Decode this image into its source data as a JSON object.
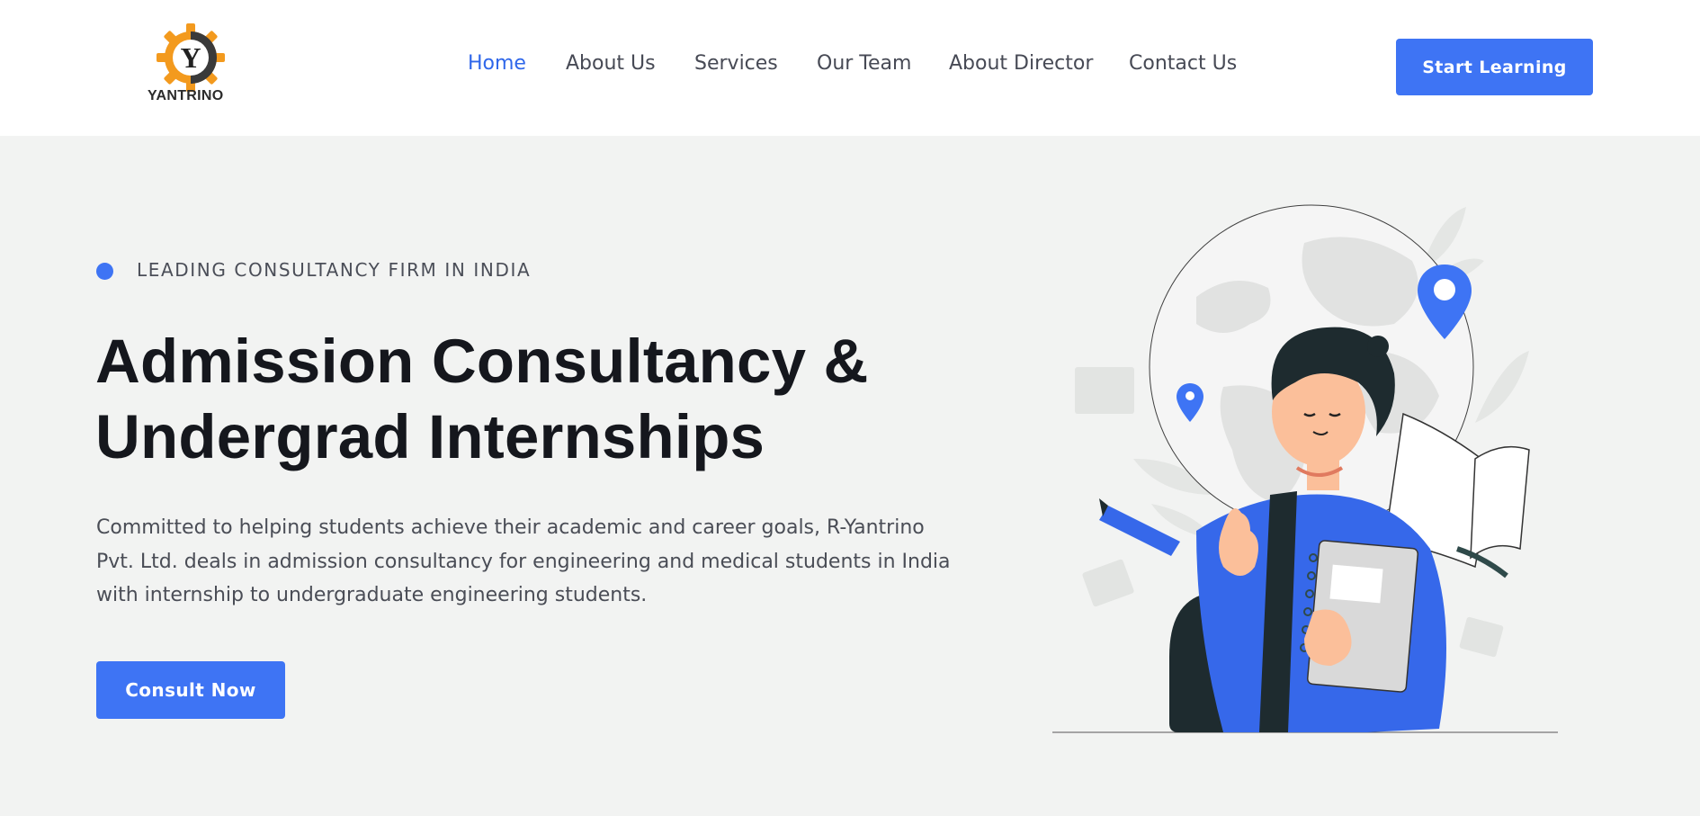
{
  "header": {
    "logo_text": "YANTRINO",
    "logo_letter": "Y",
    "nav": [
      {
        "label": "Home",
        "active": true
      },
      {
        "label": "About Us",
        "active": false
      },
      {
        "label": "Services",
        "active": false
      },
      {
        "label": "Our Team",
        "active": false
      },
      {
        "label": "About Director",
        "active": false
      },
      {
        "label": "Contact Us",
        "active": false
      }
    ],
    "cta_label": "Start Learning"
  },
  "hero": {
    "eyebrow": "LEADING CONSULTANCY FIRM IN INDIA",
    "headline_line1": "Admission Consultancy &",
    "headline_line2": "Undergrad Internships",
    "description": "Committed to helping students achieve their academic and career goals, R-Yantrino Pvt. Ltd. deals in admission consultancy for engineering and medical students in India with internship to undergraduate engineering students.",
    "cta_label": "Consult Now"
  },
  "illustration": {
    "icon": "student-with-globe-illustration"
  },
  "colors": {
    "accent": "#3e74f4",
    "nav_active": "#2f67ea",
    "background": "#f2f3f2",
    "header_bg": "#ffffff",
    "logo_orange": "#f39a1e"
  }
}
